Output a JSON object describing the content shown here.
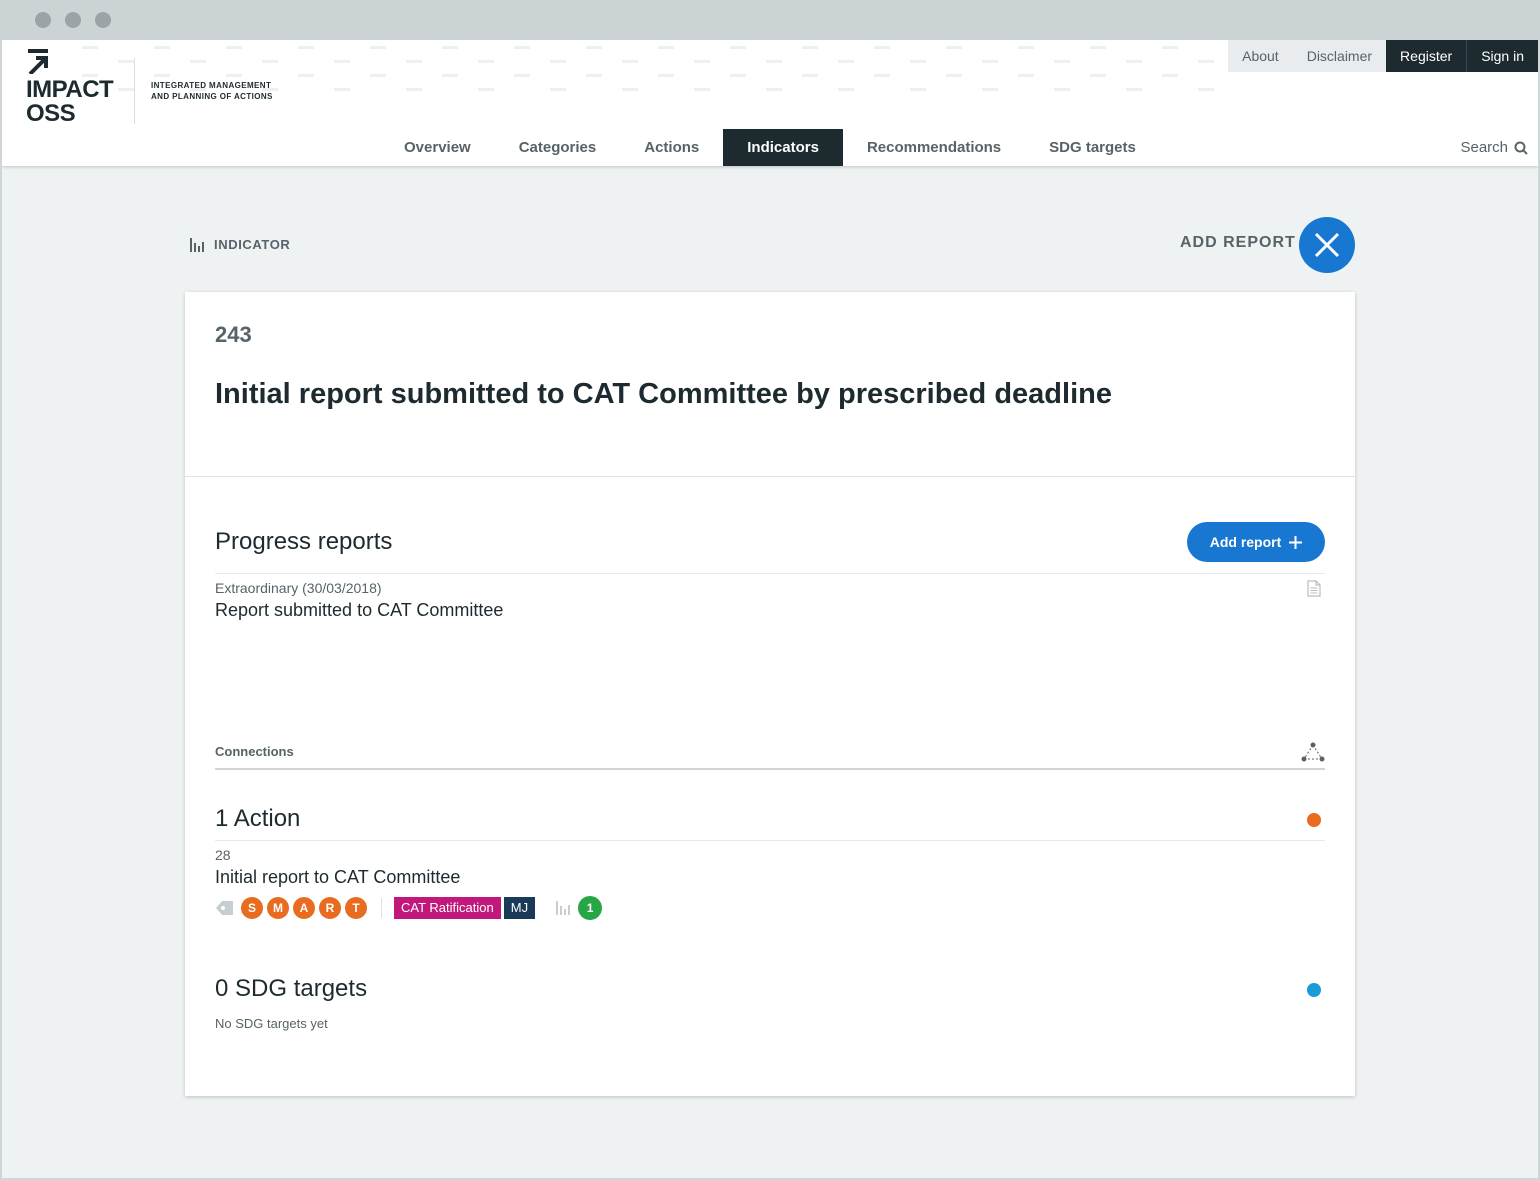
{
  "header": {
    "logo": {
      "line1": "IMPACT",
      "line2": "OSS"
    },
    "claim": [
      "INTEGRATED MANAGEMENT",
      "AND PLANNING OF ACTIONS"
    ],
    "top_links": [
      "About",
      "Disclaimer",
      "Register",
      "Sign in"
    ],
    "nav": [
      "Overview",
      "Categories",
      "Actions",
      "Indicators",
      "Recommendations",
      "SDG targets"
    ],
    "nav_active": "Indicators",
    "search_label": "Search"
  },
  "page": {
    "kind": "INDICATOR",
    "add_report_label": "ADD REPORT",
    "close_icon": "close-icon"
  },
  "indicator": {
    "ref": "243",
    "title": "Initial report submitted to CAT Committee by prescribed deadline"
  },
  "progress": {
    "title": "Progress reports",
    "add_button": "Add report",
    "reports": [
      {
        "date": "Extraordinary (30/03/2018)",
        "text": "Report submitted to CAT Committee"
      }
    ]
  },
  "connections": {
    "label": "Connections",
    "actions": {
      "title": "1 Action",
      "dot_color": "#e86b1f",
      "items": [
        {
          "ref": "28",
          "title": "Initial report to CAT Committee",
          "smart": [
            "S",
            "M",
            "A",
            "R",
            "T"
          ],
          "tags": [
            {
              "label": "CAT Ratification",
              "color": "#c2187c"
            },
            {
              "label": "MJ",
              "color": "#1b3a57"
            }
          ],
          "indicator_count": "1"
        }
      ]
    },
    "sdg": {
      "title": "0 SDG targets",
      "dot_color": "#1a9ad6",
      "empty": "No SDG targets yet"
    }
  },
  "colors": {
    "accent": "#1877d0",
    "dark": "#1d2a2f",
    "smart": "#e86b1f",
    "count": "#27a644"
  }
}
